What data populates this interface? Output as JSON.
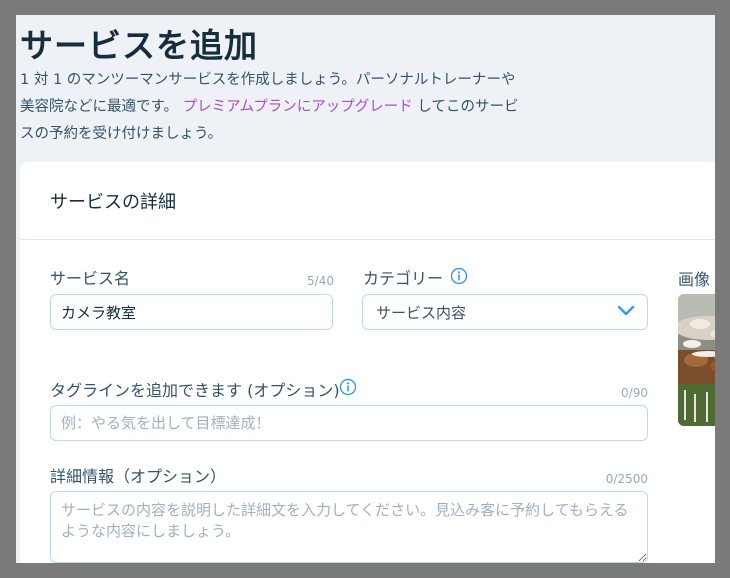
{
  "header": {
    "title": "サービスを追加",
    "intro_line1": "1 対 1 のマンツーマンサービスを作成しましょう。パーソナルトレーナーや",
    "intro_line2_pre": "美容院などに最適です。",
    "upgrade_link": "プレミアムプランにアップグレード",
    "intro_line2_post": "してこのサービ",
    "intro_line3": "スの予約を受け付けましょう。"
  },
  "card": {
    "title": "サービスの詳細",
    "service_name": {
      "label": "サービス名",
      "counter": "5/40",
      "value": "カメラ教室"
    },
    "category": {
      "label": "カテゴリー",
      "value": "サービス内容"
    },
    "image": {
      "label": "画像"
    },
    "tagline": {
      "label": "タグラインを追加できます (オプション)",
      "counter": "0/90",
      "placeholder": "例：やる気を出して目標達成！"
    },
    "details": {
      "label": "詳細情報（オプション）",
      "counter": "0/2500",
      "placeholder": "サービスの内容を説明した詳細文を入力してください。見込み客に予約してもらえるような内容にしましょう。"
    }
  },
  "colors": {
    "accent": "#3899ec",
    "link": "#aa4dc8",
    "title": "#162d3d"
  },
  "icons": {
    "info": "info-icon",
    "dropdown": "chevron-down-icon"
  }
}
